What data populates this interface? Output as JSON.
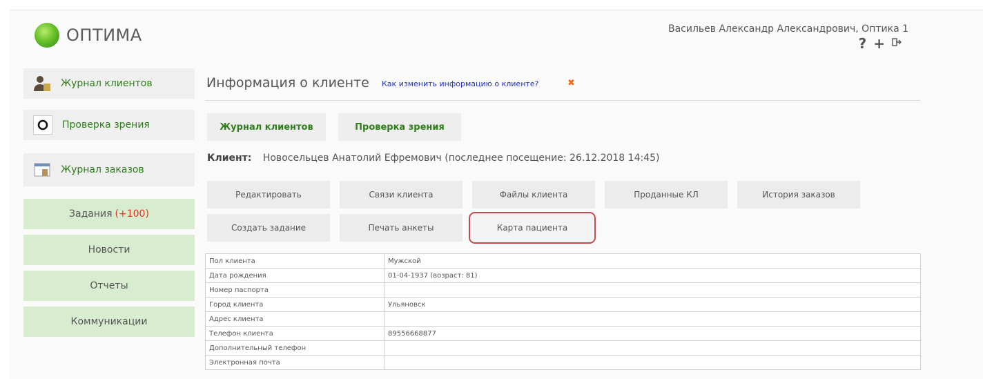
{
  "header": {
    "logo_text": "ОПТИМА",
    "user": "Васильев Александр Александрович, Оптика 1",
    "icons": [
      "help-icon",
      "plus-icon",
      "logout-icon"
    ]
  },
  "sidebar": {
    "nav": [
      {
        "label": "Журнал клиентов",
        "icon": "user-icon"
      },
      {
        "label": "Проверка зрения",
        "icon": "eye-test-icon"
      },
      {
        "label": "Журнал заказов",
        "icon": "order-log-icon"
      }
    ],
    "menu": [
      {
        "label": "Задания",
        "count": "(+100)"
      },
      {
        "label": "Новости"
      },
      {
        "label": "Отчеты"
      },
      {
        "label": "Коммуникации"
      }
    ]
  },
  "main": {
    "title": "Информация о клиенте",
    "help_link": "Как изменить информацию о клиенте?",
    "tabs": [
      "Журнал клиентов",
      "Проверка зрения"
    ],
    "client_label": "Клиент:",
    "client_value": "Новосельцев Анатолий Ефремович (последнее посещение: 26.12.2018 14:45)",
    "actions_row1": [
      "Редактировать",
      "Связи клиента",
      "Файлы клиента",
      "Проданные КЛ",
      "История заказов"
    ],
    "actions_row2": [
      "Создать задание",
      "Печать анкеты",
      "Карта пациента"
    ],
    "highlighted_action": "Карта пациента",
    "info_rows": [
      {
        "key": "Пол клиента",
        "value": "Мужской"
      },
      {
        "key": "Дата рождения",
        "value": "01-04-1937 (возраст: 81)"
      },
      {
        "key": "Номер паспорта",
        "value": ""
      },
      {
        "key": "Город клиента",
        "value": "Ульяновск"
      },
      {
        "key": "Адрес клиента",
        "value": ""
      },
      {
        "key": "Телефон клиента",
        "value": "89556668877"
      },
      {
        "key": "Дополнительный телефон",
        "value": ""
      },
      {
        "key": "Электронная почта",
        "value": ""
      }
    ]
  },
  "colors": {
    "accent_green": "#2f7f1a",
    "menu_green": "#d8ecd0",
    "highlight_red": "#c8474a",
    "count_red": "#e3341f"
  }
}
